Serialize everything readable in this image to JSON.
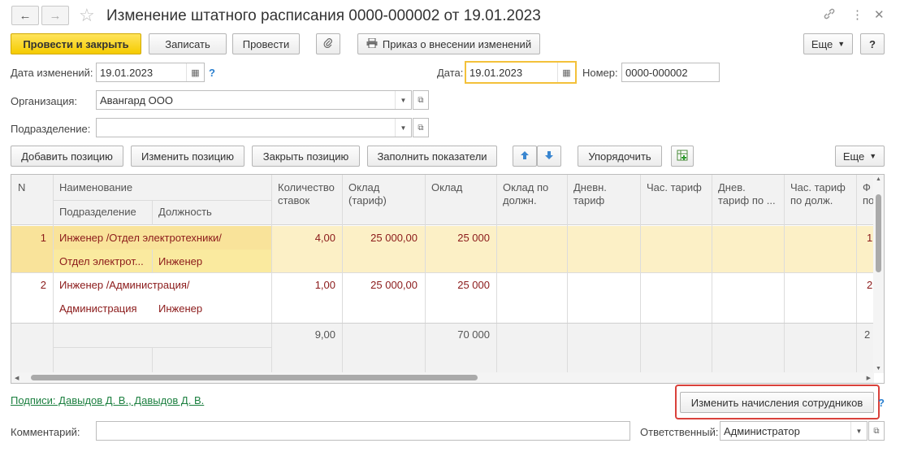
{
  "window": {
    "title": "Изменение штатного расписания 0000-000002 от 19.01.2023",
    "back_icon": "arrow-left-icon",
    "forward_icon": "arrow-right-icon",
    "favorite_icon": "star-icon",
    "link_icon": "link-icon",
    "menu_icon": "more-vertical-icon",
    "close_icon": "close-icon"
  },
  "toolbar": {
    "post_close": "Провести и закрыть",
    "save": "Записать",
    "post": "Провести",
    "order": "Приказ о внесении изменений",
    "more": "Еще",
    "help": "?"
  },
  "form": {
    "change_date_label": "Дата изменений:",
    "change_date_value": "19.01.2023",
    "date_label": "Дата:",
    "date_value": "19.01.2023",
    "number_label": "Номер:",
    "number_value": "0000-000002",
    "org_label": "Организация:",
    "org_value": "Авангард ООО",
    "dept_label": "Подразделение:",
    "dept_value": "",
    "help_mark": "?"
  },
  "table_toolbar": {
    "add": "Добавить позицию",
    "edit": "Изменить позицию",
    "close": "Закрыть позицию",
    "fill": "Заполнить показатели",
    "sort": "Упорядочить",
    "more": "Еще"
  },
  "table": {
    "headers": {
      "n": "N",
      "name": "Наименование",
      "dept": "Подразделение",
      "position": "Должность",
      "count": "Количество ставок",
      "salary_tariff": "Оклад (тариф)",
      "salary": "Оклад",
      "salary_by_pos": "Оклад по должн.",
      "day_tariff": "Дневн. тариф",
      "hour_tariff": "Час. тариф",
      "day_tariff_by": "Днев. тариф по ...",
      "hour_tariff_by": "Час. тариф по долж.",
      "cut": "Ф по"
    },
    "rows": [
      {
        "n": "1",
        "name": "Инженер /Отдел электротехники/",
        "dept": "Отдел электрот...",
        "position": "Инженер",
        "count": "4,00",
        "salary_tariff": "25 000,00",
        "salary": "25 000",
        "cut": "1"
      },
      {
        "n": "2",
        "name": "Инженер /Администрация/",
        "dept": "Администрация",
        "position": "Инженер",
        "count": "1,00",
        "salary_tariff": "25 000,00",
        "salary": "25 000",
        "cut": "2"
      }
    ],
    "totals": {
      "count": "9,00",
      "salary": "70 000",
      "cut": "2"
    }
  },
  "footer": {
    "signatures": "Подписи: Давыдов Д. В., Давыдов Д. В.",
    "change_accruals": "Изменить начисления сотрудников",
    "help_mark": "?",
    "comment_label": "Комментарий:",
    "comment_value": "",
    "responsible_label": "Ответственный:",
    "responsible_value": "Администратор"
  },
  "colors": {
    "primary_button": "#f5cb00",
    "selected_row": "#fcf0c6",
    "row_text": "#8b1a1a",
    "link": "#1b7f3f",
    "focus_border": "#f3c13a",
    "highlight_box": "#d9413b"
  }
}
